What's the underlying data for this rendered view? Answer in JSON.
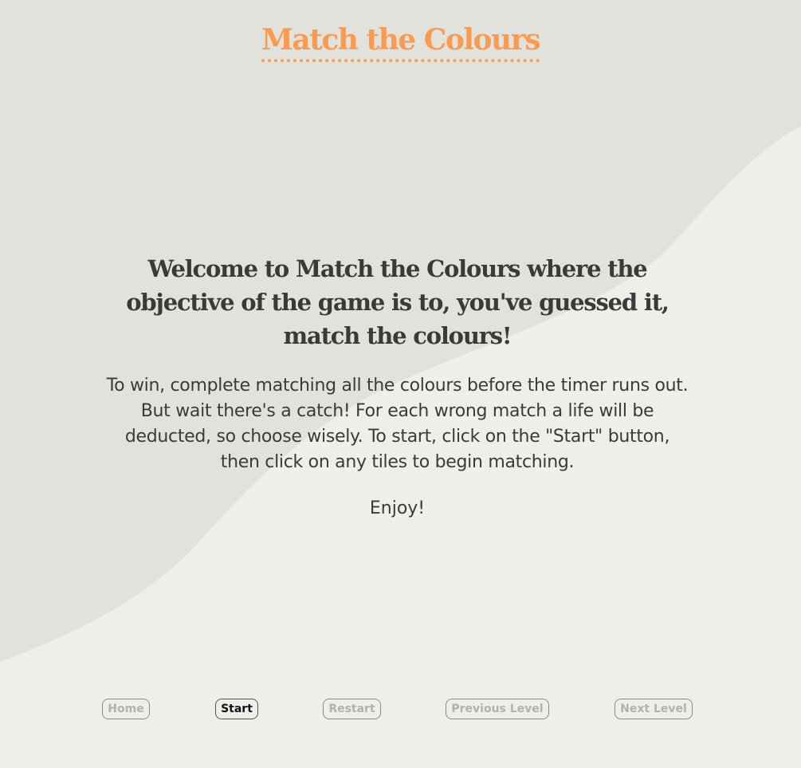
{
  "app": {
    "title": "Match the Colours"
  },
  "main": {
    "welcome_heading": "Welcome to Match the Colours where the objective of the game is to, you've guessed it, match the colours!",
    "instructions": "To win, complete matching all the colours before the timer runs out. But wait there's a catch! For each wrong match a life will be deducted, so choose wisely. To start, click on the \"Start\" button, then click on any tiles to begin matching.",
    "enjoy": "Enjoy!"
  },
  "nav": {
    "home_label": "Home",
    "start_label": "Start",
    "restart_label": "Restart",
    "previous_label": "Previous Level",
    "next_label": "Next Level"
  },
  "colors": {
    "accent": "#fa9b4f",
    "text": "#3a3a38",
    "background_light": "#eeeeeb",
    "background_dark": "#e1e1dc",
    "disabled_text": "#b6b0ab"
  }
}
